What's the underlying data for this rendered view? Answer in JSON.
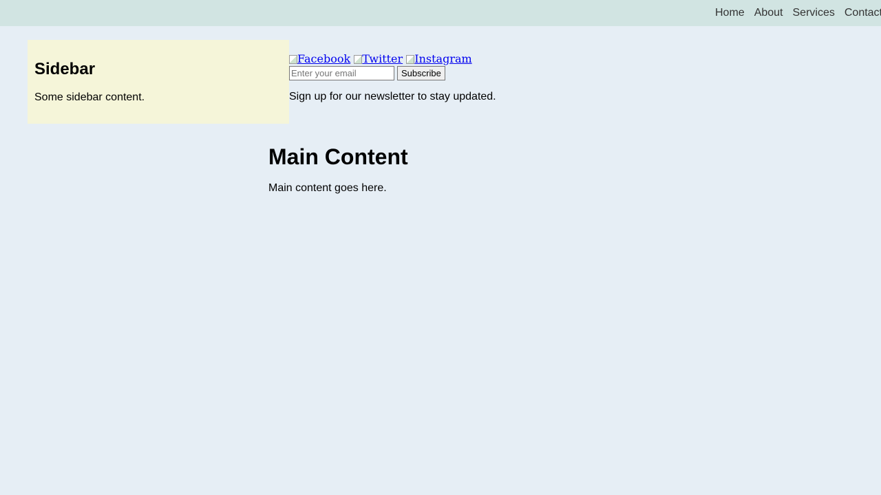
{
  "nav": {
    "items": [
      "Home",
      "About",
      "Services",
      "Contact"
    ]
  },
  "sidebar": {
    "title": "Sidebar",
    "text": "Some sidebar content."
  },
  "social": {
    "links": [
      "Facebook",
      "Twitter",
      "Instagram"
    ]
  },
  "newsletter": {
    "email_placeholder": "Enter your email",
    "email_value": "",
    "subscribe_label": "Subscribe",
    "text": "Sign up for our newsletter to stay updated."
  },
  "main": {
    "title": "Main Content",
    "text": "Main content goes here."
  },
  "colors": {
    "page_background": "#e6eef5",
    "header_background": "#d1e4e2",
    "sidebar_background": "#f5f5d9",
    "link": "#0000ee"
  }
}
